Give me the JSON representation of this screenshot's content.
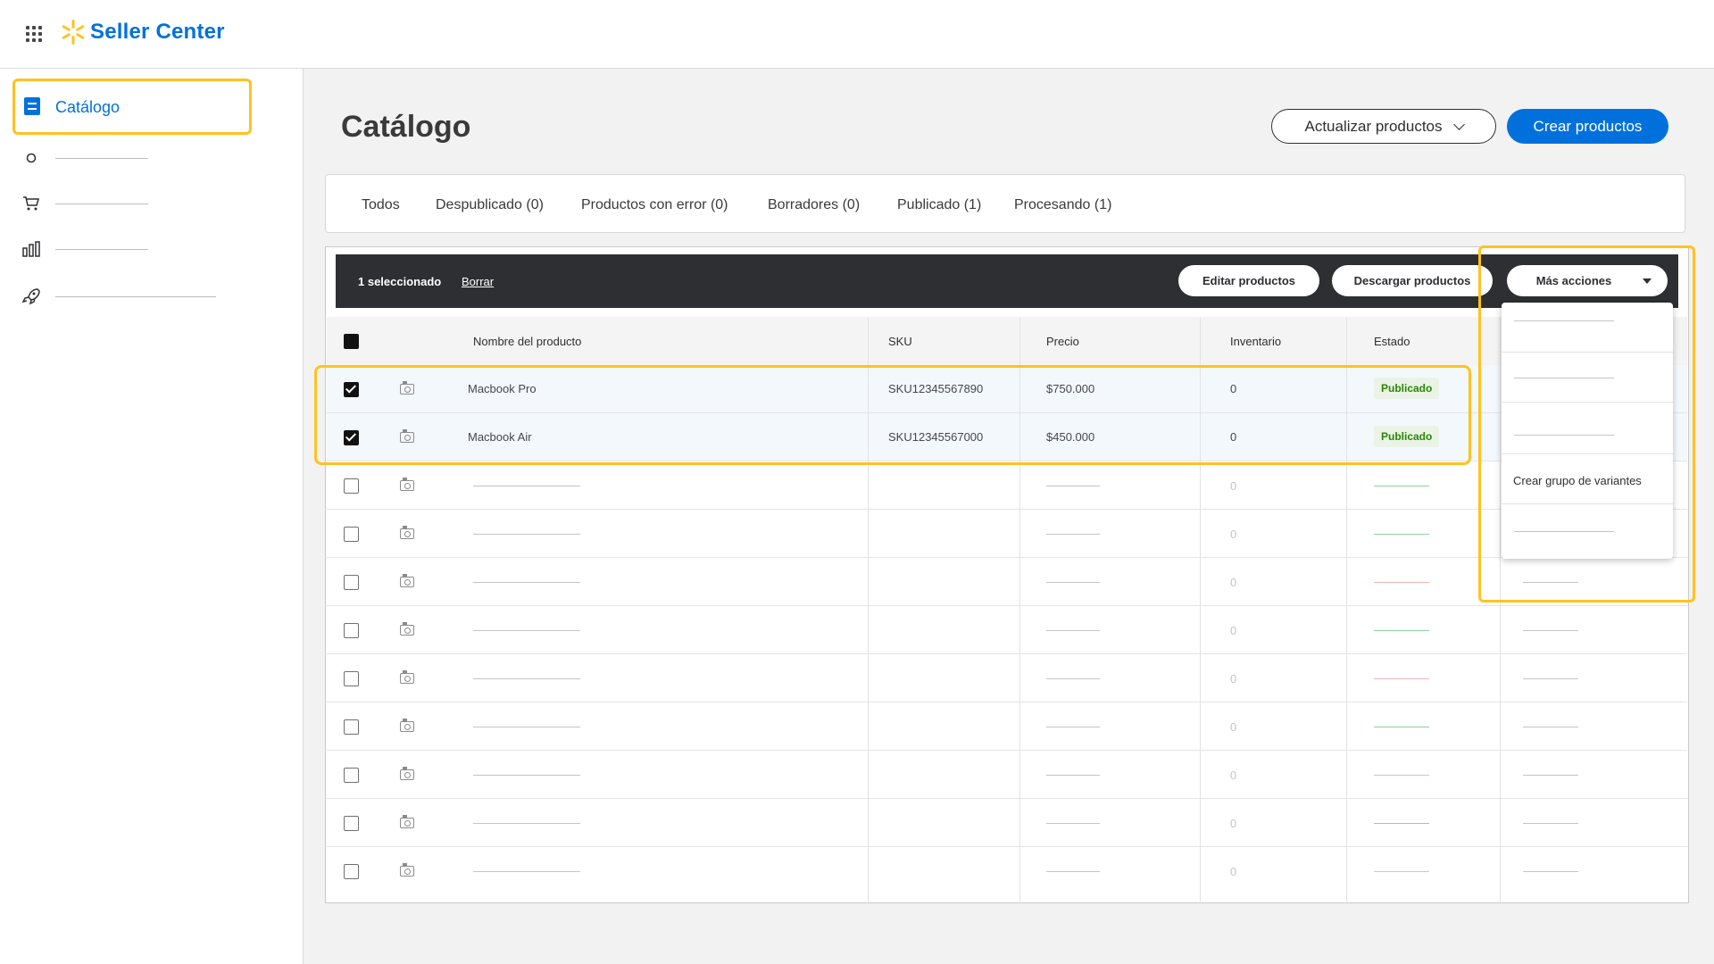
{
  "header": {
    "brand": "Seller Center"
  },
  "sidebar": {
    "active_item": "Catálogo"
  },
  "page": {
    "title": "Catálogo",
    "update_label": "Actualizar productos",
    "create_label": "Crear productos"
  },
  "tabs": [
    "Todos",
    "Despublicado (0)",
    "Productos con error (0)",
    "Borradores (0)",
    "Publicado (1)",
    "Procesando (1)"
  ],
  "bulk_bar": {
    "selected_text": "1 seleccionado",
    "clear_label": "Borrar",
    "edit_label": "Editar productos",
    "download_label": "Descargar productos",
    "more_label": "Más acciones"
  },
  "columns": {
    "name": "Nombre del producto",
    "sku": "SKU",
    "price": "Precio",
    "inventory": "Inventario",
    "status": "Estado"
  },
  "rows": [
    {
      "name": "Macbook Pro",
      "sku": "SKU12345567890",
      "price": "$750.000",
      "inventory": "0",
      "status": "Publicado"
    },
    {
      "name": "Macbook Air",
      "sku": "SKU12345567000",
      "price": "$450.000",
      "inventory": "0",
      "status": "Publicado"
    }
  ],
  "placeholder_inventory": "0",
  "menu": {
    "create_variants": "Crear grupo de variantes"
  },
  "colors": {
    "brand_blue": "#0071dc",
    "highlight_yellow": "#ffc220",
    "published_green": "#2a8703"
  }
}
